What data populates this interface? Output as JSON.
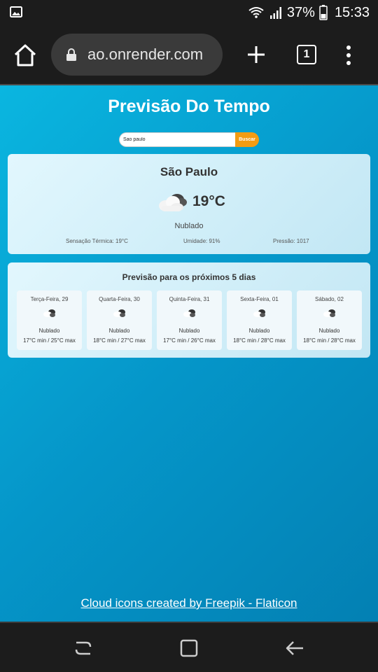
{
  "status_bar": {
    "battery_percent": "37%",
    "time": "15:33",
    "icons": [
      "image-icon",
      "wifi-icon",
      "signal-icon",
      "battery-icon"
    ]
  },
  "browser": {
    "url": "ao.onrender.com",
    "tab_count": "1",
    "icons": [
      "home-icon",
      "lock-icon",
      "plus-icon",
      "tabs-icon",
      "more-vert-icon"
    ]
  },
  "page": {
    "title": "Previsão Do Tempo",
    "search": {
      "value": "Sao paulo",
      "button_label": "Buscar"
    },
    "current": {
      "city": "São Paulo",
      "temperature": "19°C",
      "condition": "Nublado",
      "feels_like": "Sensação Térmica: 19°C",
      "humidity": "Umidade: 91%",
      "pressure": "Pressão: 1017",
      "icon": "cloud-icon"
    },
    "forecast": {
      "title": "Previsão para os próximos 5 dias",
      "days": [
        {
          "day": "Terça-Feira, 29",
          "condition": "Nublado",
          "range": "17°C min / 25°C max"
        },
        {
          "day": "Quarta-Feira, 30",
          "condition": "Nublado",
          "range": "18°C min / 27°C max"
        },
        {
          "day": "Quinta-Feira, 31",
          "condition": "Nublado",
          "range": "17°C min / 26°C max"
        },
        {
          "day": "Sexta-Feira, 01",
          "condition": "Nublado",
          "range": "18°C min / 28°C max"
        },
        {
          "day": "Sábado, 02",
          "condition": "Nublado",
          "range": "18°C min / 28°C max"
        }
      ]
    },
    "credit": "Cloud icons created by Freepik - Flaticon",
    "colors": {
      "accent": "#f39c12",
      "background_start": "#0ab6e0",
      "background_end": "#0380b3"
    }
  },
  "nav_bar": {
    "icons": [
      "recents-icon",
      "home-square-icon",
      "back-icon"
    ]
  }
}
